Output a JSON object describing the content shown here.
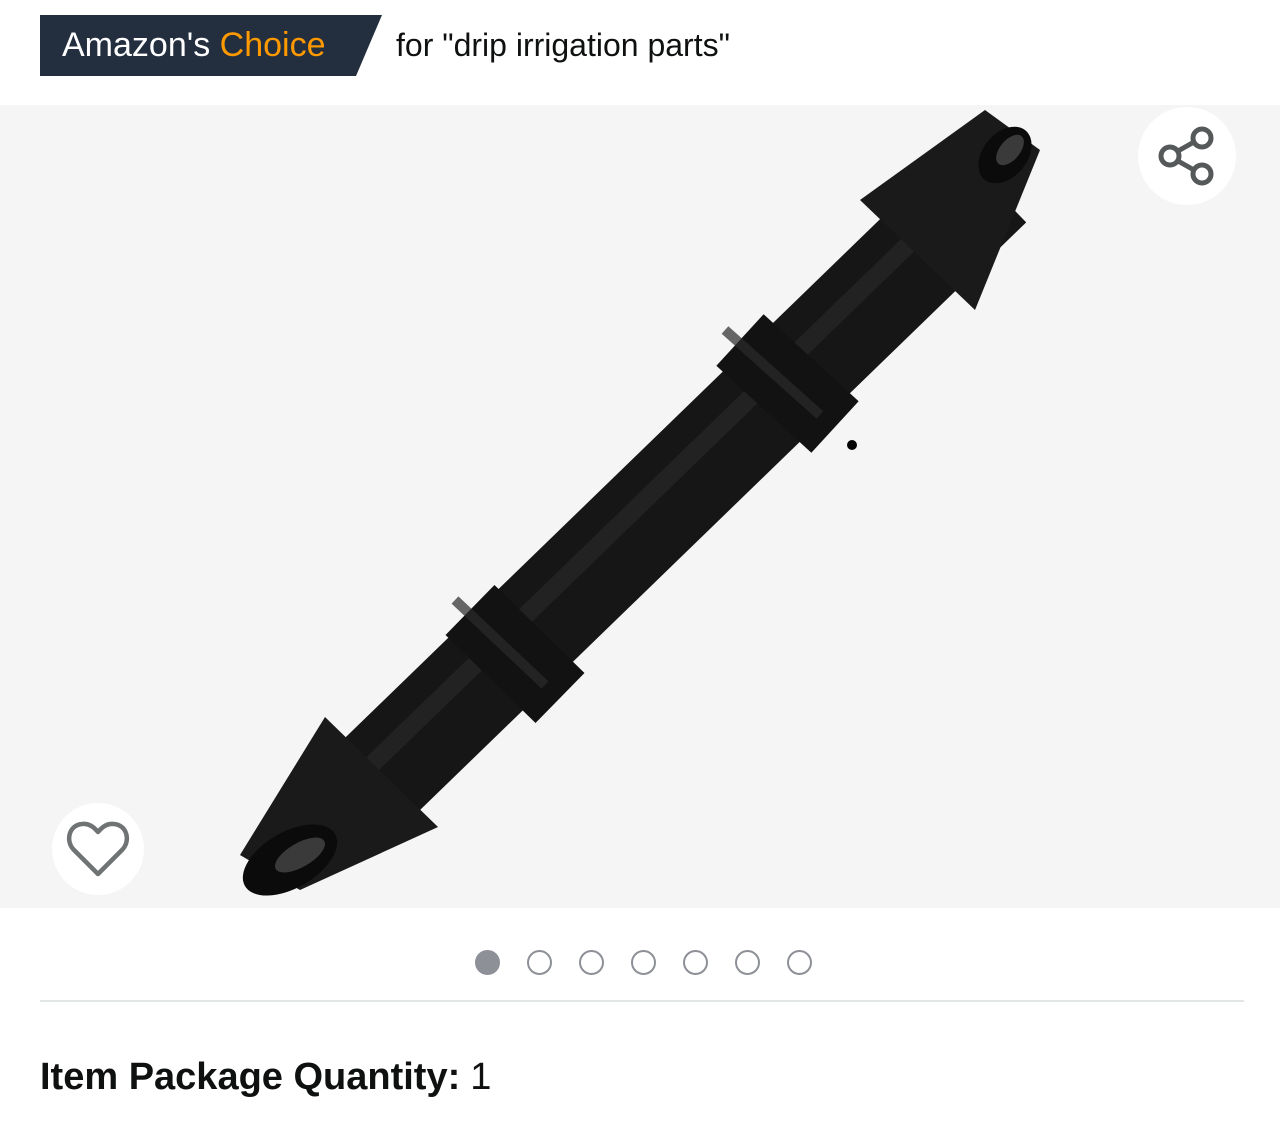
{
  "badge": {
    "prefix": "Amazon's",
    "highlight": "Choice",
    "context": "for \"drip irrigation parts\"",
    "background_color": "#232f3e",
    "accent_color": "#ff9900"
  },
  "gallery": {
    "image_alt": "Black barbed drip irrigation coupling connector",
    "share_icon": "share-icon",
    "wishlist_icon": "heart-outline-icon",
    "image_count": 7,
    "active_index": 0
  },
  "details": {
    "quantity_label": "Item Package Quantity:",
    "quantity_value": "1"
  }
}
